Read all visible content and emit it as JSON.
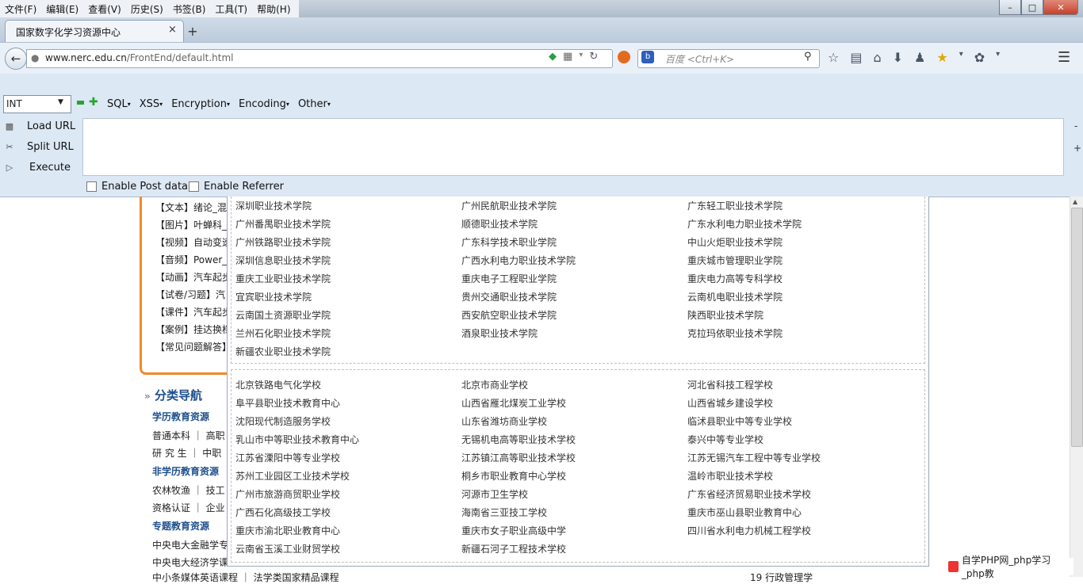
{
  "menubar": [
    "文件(F)",
    "编辑(E)",
    "查看(V)",
    "历史(S)",
    "书签(B)",
    "工具(T)",
    "帮助(H)"
  ],
  "window_controls": [
    "–",
    "□",
    "✕"
  ],
  "tab": {
    "title": "国家数字化学习资源中心",
    "close": "×",
    "new": "+"
  },
  "nav": {
    "url_host": "www.nerc.edu.cn",
    "url_path": "/FrontEnd/default.html",
    "search_placeholder": "百度 <Ctrl+K>"
  },
  "hackbar": {
    "type_select": "INT",
    "menus": [
      "SQL",
      "XSS",
      "Encryption",
      "Encoding",
      "Other"
    ],
    "actions": [
      "Load URL",
      "Split URL",
      "Execute"
    ],
    "checks": [
      "Enable Post data",
      "Enable Referrer"
    ],
    "side_minus": "-",
    "side_plus": "+"
  },
  "left_list": [
    "【文本】绪论_混",
    "【图片】叶蝉科_",
    "【视频】自动变速",
    "【音频】Power_:",
    "【动画】汽车起步",
    "【试卷/习题】汽",
    "【课件】汽车起步",
    "【案例】挂达换档",
    "【常见问题解答】"
  ],
  "category_nav": {
    "title": "分类导航",
    "sections": [
      {
        "head": "学历教育资源",
        "rows": [
          "普通本科 ｜ 高职",
          "研 究 生 ｜ 中职"
        ]
      },
      {
        "head": "非学历教育资源",
        "rows": [
          "农林牧渔 ｜ 技工",
          "资格认证 ｜ 企业"
        ]
      },
      {
        "head": "专题教育资源",
        "rows": [
          "中央电大金融学专",
          "中央电大经济学课"
        ]
      }
    ],
    "bottom_cut": "中小条媒体英语课程 ｜ 法学类国家精品课程",
    "bottom_right_cut": "19 行政管理学"
  },
  "schools_group1": [
    [
      "深圳职业技术学院",
      "广州民航职业技术学院",
      "广东轻工职业技术学院"
    ],
    [
      "广州番禺职业技术学院",
      "顺德职业技术学院",
      "广东水利电力职业技术学院"
    ],
    [
      "广州铁路职业技术学院",
      "广东科学技术职业学院",
      "中山火炬职业技术学院"
    ],
    [
      "深圳信息职业技术学院",
      "广西水利电力职业技术学院",
      "重庆城市管理职业学院"
    ],
    [
      "重庆工业职业技术学院",
      "重庆电子工程职业学院",
      "重庆电力高等专科学校"
    ],
    [
      "宜宾职业技术学院",
      "贵州交通职业技术学院",
      "云南机电职业技术学院"
    ],
    [
      "云南国土资源职业学院",
      "西安航空职业技术学院",
      "陕西职业技术学院"
    ],
    [
      "兰州石化职业技术学院",
      "酒泉职业技术学院",
      "克拉玛依职业技术学院"
    ],
    [
      "新疆农业职业技术学院",
      "",
      ""
    ]
  ],
  "schools_group2": [
    [
      "北京铁路电气化学校",
      "北京市商业学校",
      "河北省科技工程学校"
    ],
    [
      "阜平县职业技术教育中心",
      "山西省雁北煤炭工业学校",
      "山西省城乡建设学校"
    ],
    [
      "沈阳现代制造服务学校",
      "山东省潍坊商业学校",
      "临沭县职业中等专业学校"
    ],
    [
      "乳山市中等职业技术教育中心",
      "无锡机电高等职业技术学校",
      "泰兴中等专业学校"
    ],
    [
      "江苏省溧阳中等专业学校",
      "江苏镇江高等职业技术学校",
      "江苏无锡汽车工程中等专业学校"
    ],
    [
      "苏州工业园区工业技术学校",
      "桐乡市职业教育中心学校",
      "温岭市职业技术学校"
    ],
    [
      "广州市旅游商贸职业学校",
      "河源市卫生学校",
      "广东省经济贸易职业技术学校"
    ],
    [
      "广西石化高级技工学校",
      "海南省三亚技工学校",
      "重庆市巫山县职业教育中心"
    ],
    [
      "重庆市渝北职业教育中心",
      "重庆市女子职业高级中学",
      "四川省水利电力机械工程学校"
    ],
    [
      "云南省玉溪工业财贸学校",
      "新疆石河子工程技术学校",
      ""
    ]
  ],
  "watermark": "自学PHP网_php学习_php教"
}
